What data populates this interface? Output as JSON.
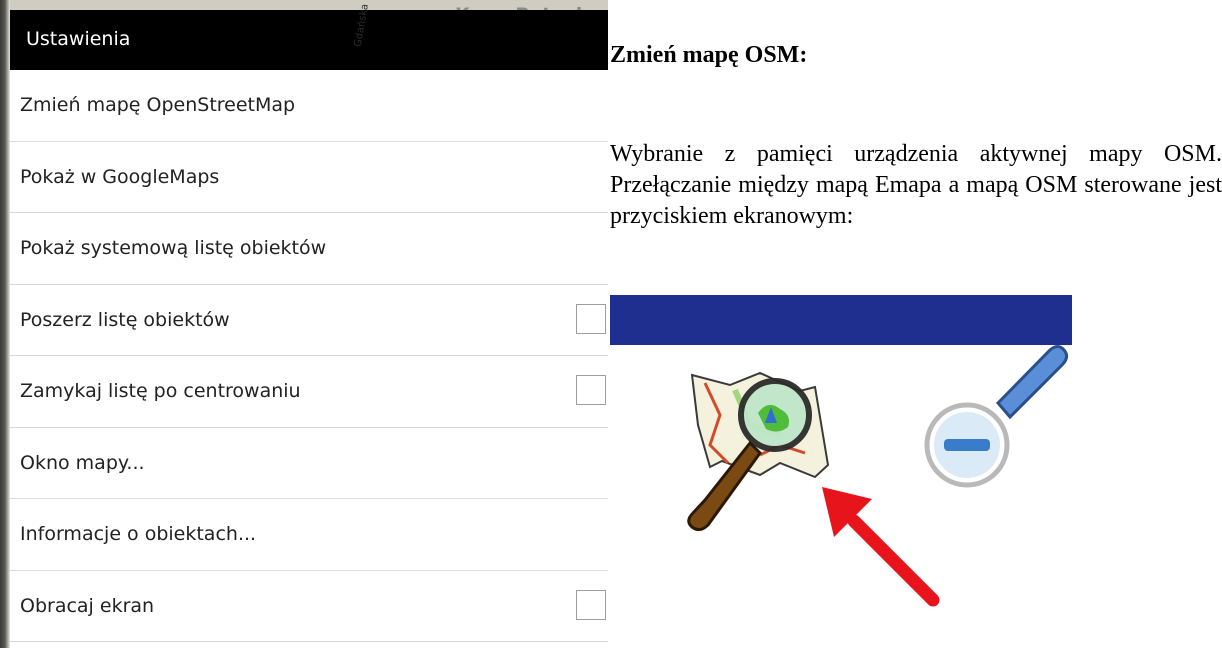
{
  "settings_screen": {
    "title": "Ustawienia",
    "background_map_label": "Kepa Potocka",
    "background_map_street_label": "Gdańska",
    "menu_items": [
      {
        "label": "Zmień mapę OpenStreetMap",
        "has_checkbox": false
      },
      {
        "label": "Pokaż w GoogleMaps",
        "has_checkbox": false
      },
      {
        "label": "Pokaż systemową listę obiektów",
        "has_checkbox": false
      },
      {
        "label": "Poszerz listę obiektów",
        "has_checkbox": true,
        "checked": false
      },
      {
        "label": "Zamykaj listę po centrowaniu",
        "has_checkbox": true,
        "checked": false
      },
      {
        "label": "Okno mapy...",
        "has_checkbox": false
      },
      {
        "label": "Informacje o obiektach...",
        "has_checkbox": false
      },
      {
        "label": "Obracaj ekran",
        "has_checkbox": true,
        "checked": false
      }
    ]
  },
  "document": {
    "heading": "Zmień mapę OSM:",
    "paragraph": "Wybranie z pamięci urządzenia aktywnej mapy OSM. Przełączanie między mapą Emapa a mapą OSM sterowane jest przyciskiem ekranowym:",
    "image": {
      "icons": [
        "osm-map-magnifier-icon",
        "zoom-out-magnifier-icon",
        "red-arrow-icon"
      ],
      "bar_color": "#1f2f8f",
      "arrow_color": "#e8141c"
    }
  }
}
